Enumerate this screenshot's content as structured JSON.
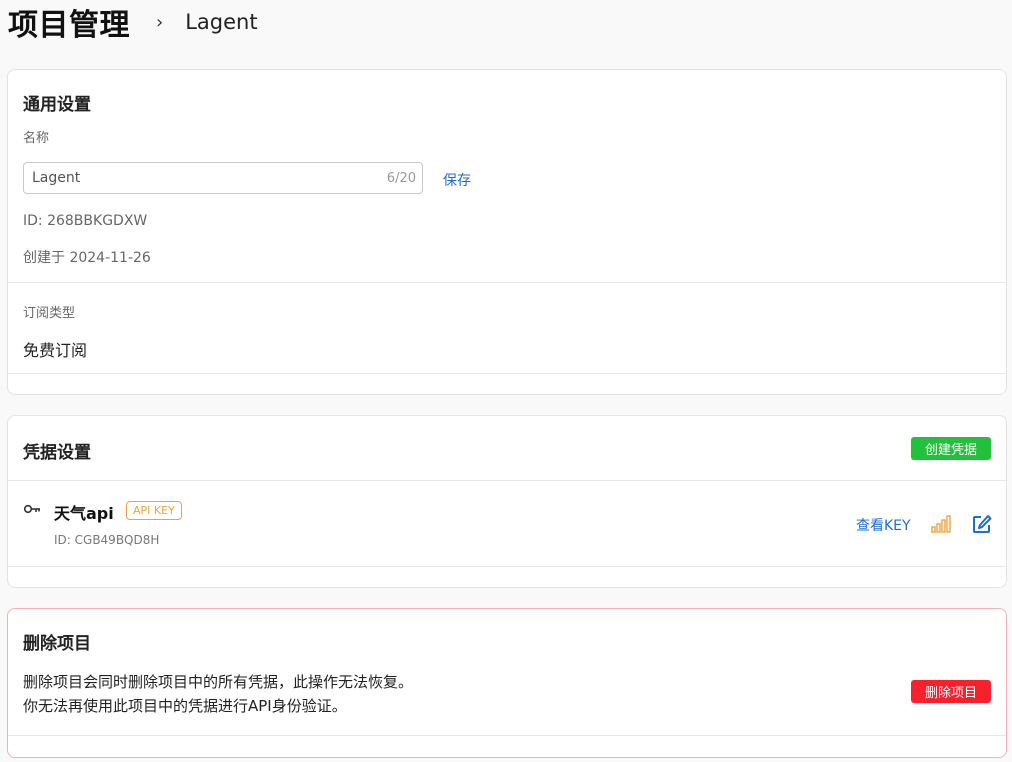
{
  "header": {
    "title": "项目管理",
    "separator": "›",
    "breadcrumb": "Lagent"
  },
  "general": {
    "title": "通用设置",
    "name_label": "名称",
    "name_value": "Lagent",
    "name_counter": "6/20",
    "save_label": "保存",
    "id_line": "ID: 268BBKGDXW",
    "created_line": "创建于 2024-11-26",
    "subscription_label": "订阅类型",
    "subscription_value": "免费订阅"
  },
  "credentials": {
    "title": "凭据设置",
    "create_label": "创建凭据",
    "items": [
      {
        "icon": "key-icon",
        "name": "天气api",
        "badge": "API KEY",
        "id_line": "ID: CGB49BQD8H",
        "view_label": "查看KEY",
        "stats_icon": "bar-chart-icon",
        "edit_icon": "edit-icon"
      }
    ]
  },
  "delete": {
    "title": "删除项目",
    "line1": "删除项目会同时删除项目中的所有凭据，此操作无法恢复。",
    "line2": "你无法再使用此项目中的凭据进行API身份验证。",
    "button_label": "删除项目"
  },
  "colors": {
    "link": "#1a6fd6",
    "create_button": "#22c13b",
    "delete_button": "#f5222d",
    "badge": "#f0a23c",
    "stats_icon": "#f0a23c",
    "edit_icon": "#1a6fd6",
    "danger_border": "#f3b2b2"
  }
}
